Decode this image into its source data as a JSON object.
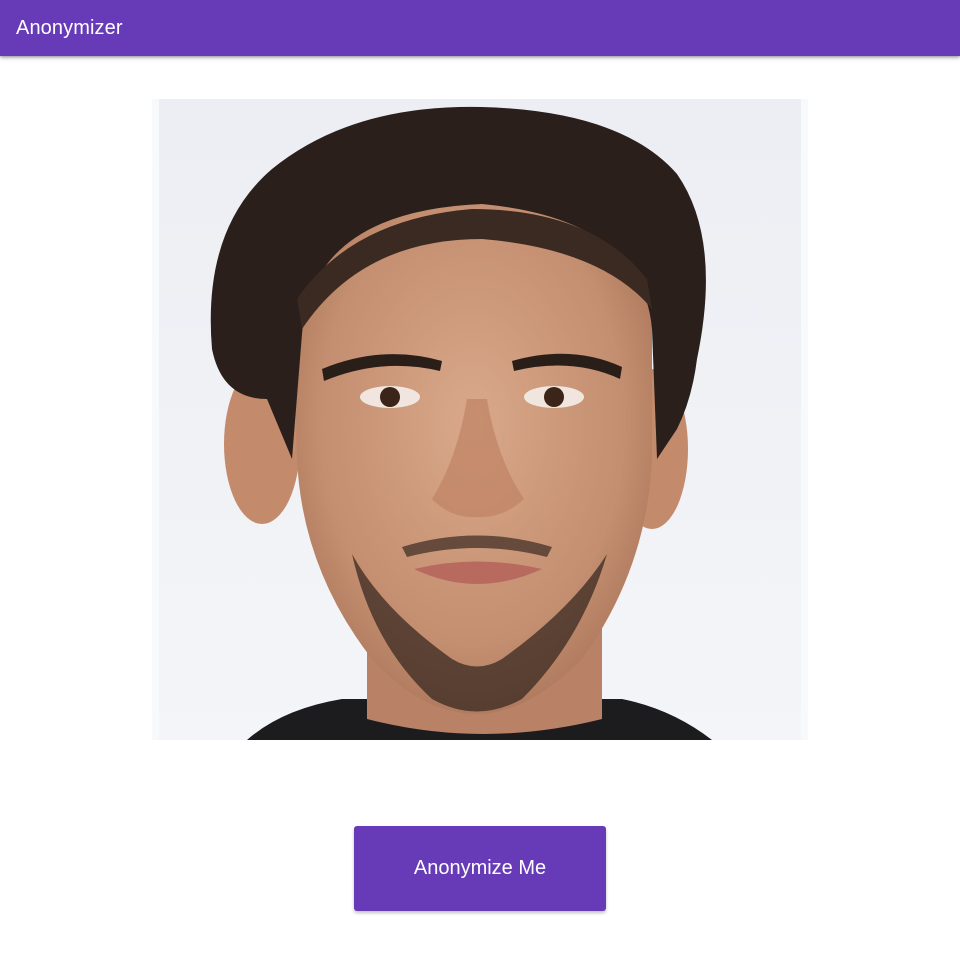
{
  "app_bar": {
    "title": "Anonymizer",
    "color": "#673ab7"
  },
  "main": {
    "portrait": {
      "icon": "portrait-photo"
    },
    "action_button": {
      "label": "Anonymize Me",
      "color": "#673ab7"
    }
  }
}
